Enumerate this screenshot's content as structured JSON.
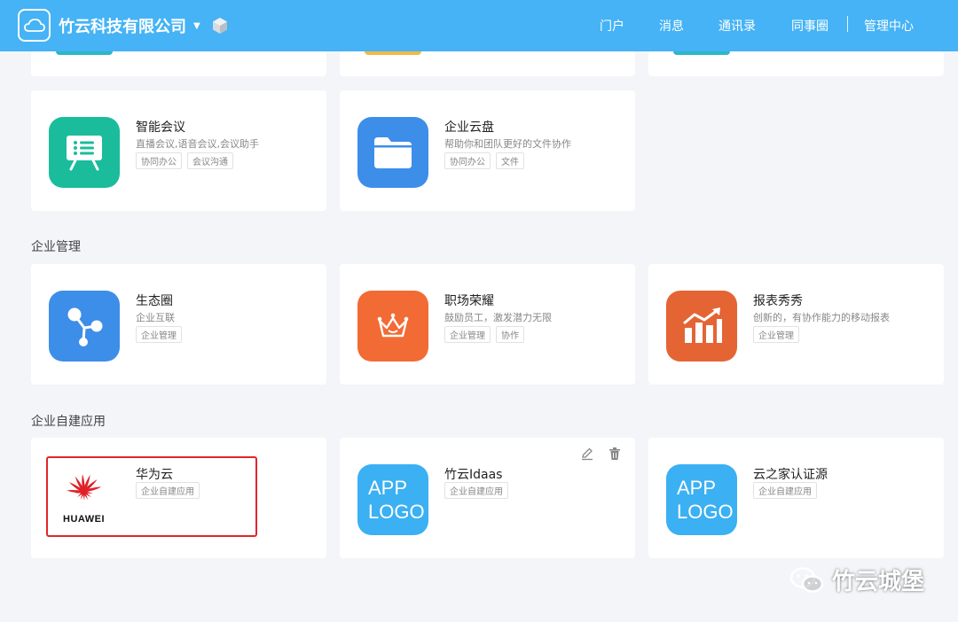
{
  "header": {
    "company": "竹云科技有限公司",
    "nav": [
      "门户",
      "消息",
      "通讯录",
      "同事圈",
      "管理中心"
    ]
  },
  "colors": {
    "header": "#45b3f5",
    "teal": "#1bbc9b",
    "blue": "#3d8ee8",
    "orange": "#f26b34",
    "red_orange": "#e56434",
    "app_logo": "#3bb0f3",
    "highlight": "#e0262b"
  },
  "apps_top": [
    {
      "title": "智能会议",
      "desc": "直播会议,语音会议,会议助手",
      "tags": [
        "协同办公",
        "会议沟通"
      ],
      "icon": "presentation-icon"
    },
    {
      "title": "企业云盘",
      "desc": "帮助你和团队更好的文件协作",
      "tags": [
        "协同办公",
        "文件"
      ],
      "icon": "folder-icon"
    }
  ],
  "sections": {
    "mgmt": "企业管理",
    "custom": "企业自建应用"
  },
  "apps_mgmt": [
    {
      "title": "生态圈",
      "desc": "企业互联",
      "tags": [
        "企业管理"
      ],
      "icon": "share-nodes-icon"
    },
    {
      "title": "职场荣耀",
      "desc": "鼓励员工，激发潜力无限",
      "tags": [
        "企业管理",
        "协作"
      ],
      "icon": "crown-icon"
    },
    {
      "title": "报表秀秀",
      "desc": "创新的，有协作能力的移动报表",
      "tags": [
        "企业管理"
      ],
      "icon": "bar-chart-icon"
    }
  ],
  "apps_custom": [
    {
      "title": "华为云",
      "tags": [
        "企业自建应用"
      ],
      "logo_text": "HUAWEI",
      "icon": "huawei-logo"
    },
    {
      "title": "竹云Idaas",
      "tags": [
        "企业自建应用"
      ],
      "logo_line1": "APP",
      "logo_line2": "LOGO",
      "icon": "app-logo-placeholder"
    },
    {
      "title": "云之家认证源",
      "tags": [
        "企业自建应用"
      ],
      "logo_line1": "APP",
      "logo_line2": "LOGO",
      "icon": "app-logo-placeholder"
    }
  ],
  "watermark": "竹云城堡"
}
